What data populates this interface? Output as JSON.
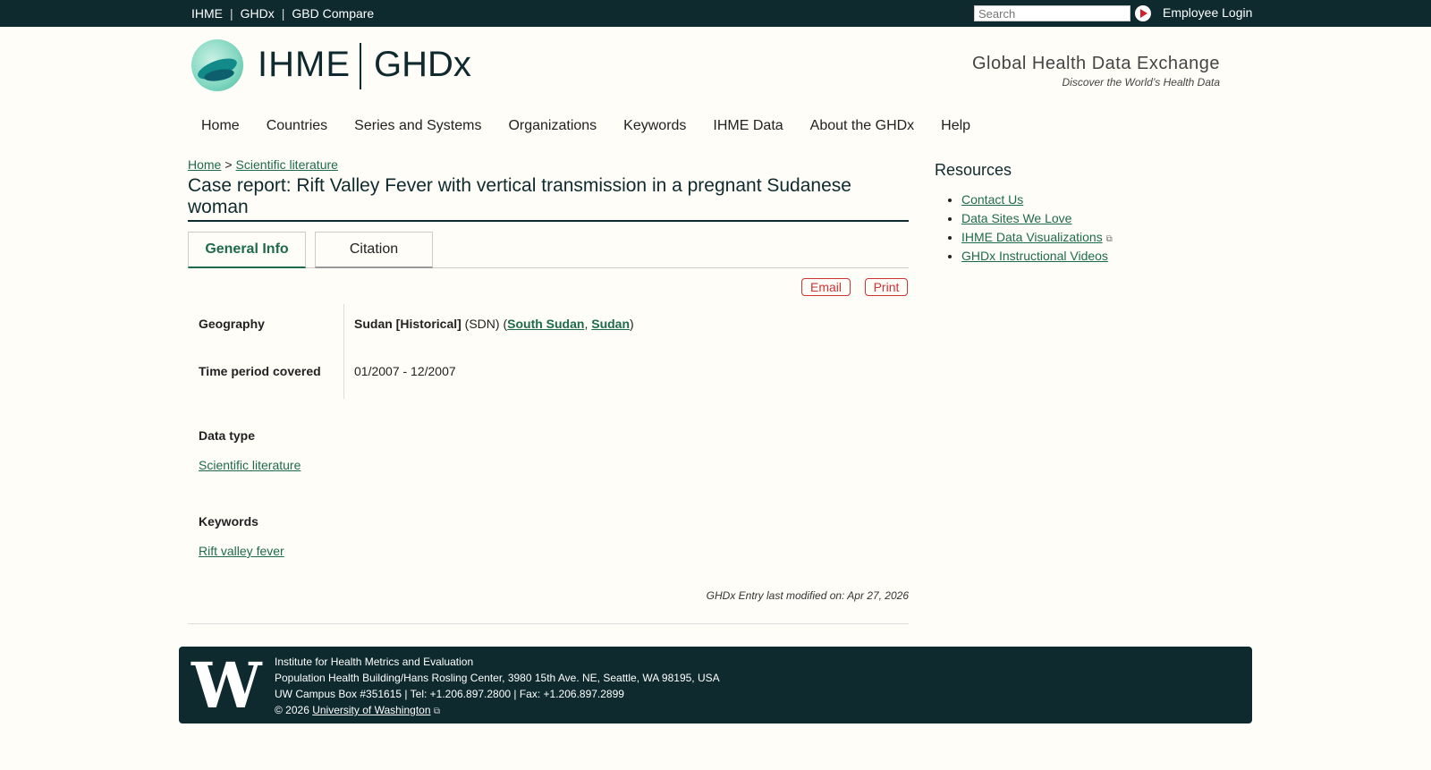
{
  "topbar": {
    "links": [
      "IHME",
      "GHDx",
      "GBD Compare"
    ],
    "search_placeholder": "Search",
    "employee_login": "Employee Login"
  },
  "header": {
    "logo_ihme": "IHME",
    "logo_ghdx": "GHDx",
    "tagline": "Global Health Data Exchange",
    "subtagline": "Discover the World’s Health Data"
  },
  "nav": {
    "items": [
      "Home",
      "Countries",
      "Series and Systems",
      "Organizations",
      "Keywords",
      "IHME Data",
      "About the GHDx",
      "Help"
    ]
  },
  "breadcrumb": {
    "home": "Home",
    "sep": ">",
    "current": "Scientific literature"
  },
  "page": {
    "title": "Case report: Rift Valley Fever with vertical transmission in a pregnant Sudanese woman",
    "tabs": [
      "General Info",
      "Citation"
    ],
    "email_label": "Email",
    "print_label": "Print"
  },
  "fields": {
    "geography_label": "Geography",
    "geography_name": "Sudan [Historical]",
    "geography_code": " (SDN) (",
    "geography_link1": "South Sudan",
    "geography_comma": ", ",
    "geography_link2": "Sudan",
    "geography_close": ")",
    "time_label": "Time period covered",
    "time_value": "01/2007 - 12/2007",
    "datatype_label": "Data type",
    "datatype_value": "Scientific literature",
    "keywords_label": "Keywords",
    "keywords_value": "Rift valley fever"
  },
  "modified": "GHDx Entry last modified on: Apr 27, 2026",
  "sidebar": {
    "title": "Resources",
    "items": [
      "Contact Us",
      "Data Sites We Love",
      "IHME Data Visualizations",
      "GHDx Instructional Videos"
    ]
  },
  "footer": {
    "line1": "Institute for Health Metrics and Evaluation",
    "line2": "Population Health Building/Hans Rosling Center, 3980 15th Ave. NE, Seattle, WA 98195, USA",
    "line3": "UW Campus Box #351615 | Tel: +1.206.897.2800 | Fax: +1.206.897.2899",
    "copyright": "© 2026 ",
    "uw_link": "University of Washington",
    "logo_letter": "W"
  }
}
